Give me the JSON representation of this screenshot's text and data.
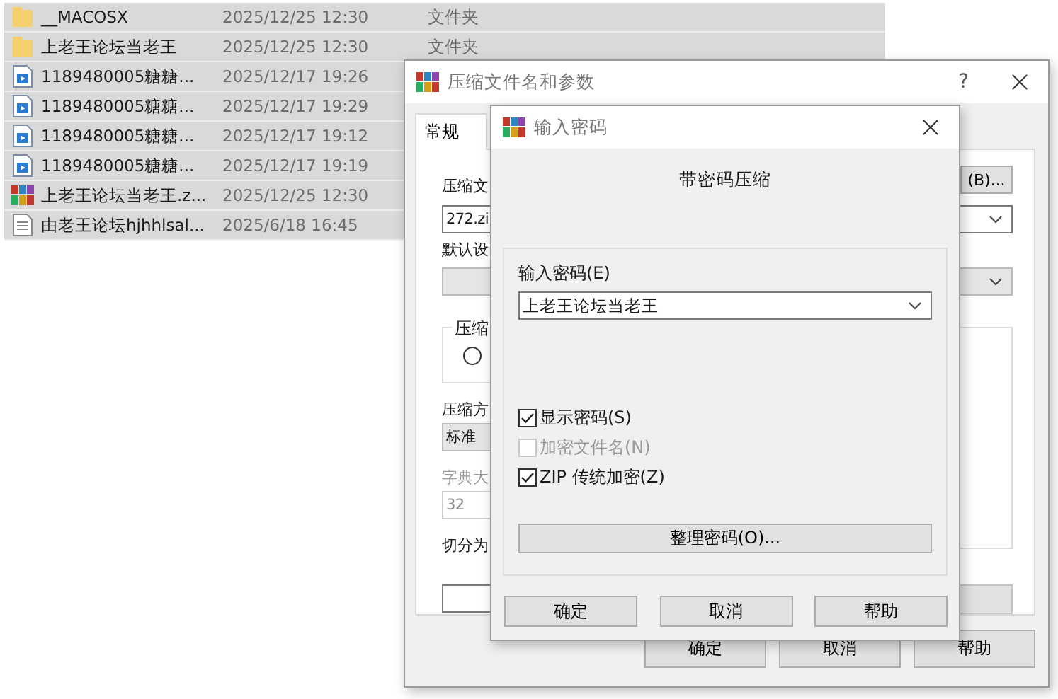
{
  "file_list": {
    "rows": [
      {
        "kind": "folder",
        "name": "__MACOSX",
        "date": "2025/12/25 12:30",
        "type": "文件夹"
      },
      {
        "kind": "folder",
        "name": "上老王论坛当老王",
        "date": "2025/12/25 12:30",
        "type": "文件夹"
      },
      {
        "kind": "video",
        "name": "1189480005糖糖...",
        "date": "2025/12/17 19:26"
      },
      {
        "kind": "video",
        "name": "1189480005糖糖...",
        "date": "2025/12/17 19:29"
      },
      {
        "kind": "video",
        "name": "1189480005糖糖...",
        "date": "2025/12/17 19:12"
      },
      {
        "kind": "video",
        "name": "1189480005糖糖...",
        "date": "2025/12/17 19:19"
      },
      {
        "kind": "archive",
        "name": "上老王论坛当老王.z...",
        "date": "2025/12/25 12:30"
      },
      {
        "kind": "text",
        "name": "由老王论坛hjhhlsal...",
        "date": "2025/6/18 16:45"
      }
    ]
  },
  "archive_dialog": {
    "title": "压缩文件名和参数",
    "help_button": "?",
    "tabs": [
      {
        "label": "常规",
        "selected": true
      }
    ],
    "browse_button": "(B)...",
    "archive_name_label": "压缩文",
    "archive_name": "272.zi",
    "profiles_label": "默认设",
    "format_group_label": "压缩",
    "format_radio": {
      "selected": false
    },
    "method_label": "压缩方",
    "method": "标准",
    "dictionary": {
      "label": "字典大",
      "value": "32",
      "disabled": true
    },
    "split_label": "切分为",
    "buttons": [
      "确定",
      "取消",
      "帮助"
    ]
  },
  "password_dialog": {
    "title": "输入密码",
    "heading": "带密码压缩",
    "password_label": "输入密码(E)",
    "password": "上老王论坛当老王",
    "options": [
      {
        "label": "显示密码(S)",
        "checked": true,
        "disabled": false
      },
      {
        "label": "加密文件名(N)",
        "checked": false,
        "disabled": true
      },
      {
        "label": "ZIP 传统加密(Z)",
        "checked": true,
        "disabled": false
      }
    ],
    "organize_button": "整理密码(O)...",
    "buttons": [
      "确定",
      "取消",
      "帮助"
    ]
  }
}
